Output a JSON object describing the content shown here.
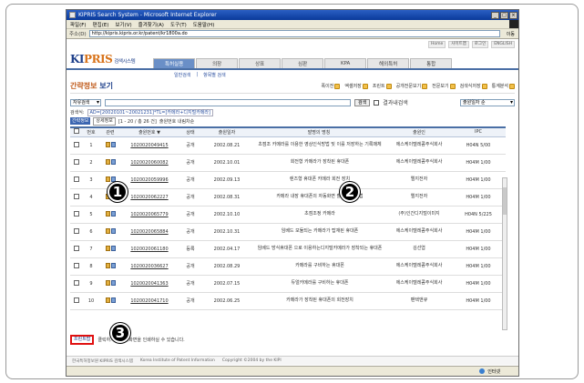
{
  "window": {
    "title": "KIPRIS Search System - Microsoft Internet Explorer",
    "controls": [
      "_",
      "□",
      "×"
    ]
  },
  "menu": [
    "파일(F)",
    "편집(E)",
    "보기(V)",
    "즐겨찾기(A)",
    "도구(T)",
    "도움말(H)"
  ],
  "address": {
    "label": "주소(D)",
    "url": "http://kipris.kipris.or.kr/patent/kr1800a.do",
    "go": "이동"
  },
  "toplinks": [
    "Home",
    "사이트맵",
    "로그인",
    "ENGLISH"
  ],
  "brand": {
    "name_a": "KI",
    "name_b": "PRIS",
    "suffix": "검색시스템"
  },
  "tabs": [
    {
      "label": "특허실용",
      "active": true
    },
    {
      "label": "의장",
      "active": false
    },
    {
      "label": "상표",
      "active": false
    },
    {
      "label": "심판",
      "active": false
    },
    {
      "label": "KPA",
      "active": false
    },
    {
      "label": "해외특허",
      "active": false
    },
    {
      "label": "통합",
      "active": false
    }
  ],
  "subtabs": [
    "일반검색",
    "항목별 검색"
  ],
  "page": {
    "title_a": "간략정보",
    "title_b": " 보기",
    "tools": [
      "폭이전",
      "엑셀저장",
      "프린트",
      "공개전문보기",
      "전문보기",
      "검색식저장",
      "통계분석"
    ]
  },
  "search": {
    "field": "자유검색",
    "button": "검색",
    "option": "결과내검색",
    "sort": "출원일자 순",
    "expr_label": "검색식:",
    "expr": "AD=[20020101~20021231]*TL=[카메라+디지털카메라]"
  },
  "results": {
    "view_a": "간략정보",
    "view_b": "상세정보",
    "summary": "[1 - 20 / 총 26 건]",
    "sort_hint": "출원번호 내림차순"
  },
  "columns": [
    "",
    "번호",
    "관련",
    "출원번호 ▼",
    "상태",
    "출원일자",
    "발명의 명칭",
    "출원인",
    "IPC"
  ],
  "rows": [
    {
      "no": "1",
      "app": "1020020049415",
      "status": "공개",
      "date": "2002.08.21",
      "title": "초점조 카메라를 이용한 영상인식방법 및 이를 저장하는 기록매체",
      "applicant": "에스케이텔레콤주식회사",
      "ipc": "H04N 5/00"
    },
    {
      "no": "2",
      "app": "1020020060082",
      "status": "공개",
      "date": "2002.10.01",
      "title": "회전형 카메라가 장착된 휴대폰",
      "applicant": "에스케이텔레콤주식회사",
      "ipc": "H04M 1/00"
    },
    {
      "no": "3",
      "app": "1020020059996",
      "status": "공개",
      "date": "2002.09.13",
      "title": "렌즈형 휴대폰 카메라 회전 장치",
      "applicant": "엘지전자",
      "ipc": "H04M 1/00"
    },
    {
      "no": "4",
      "app": "1020020062227",
      "status": "공개",
      "date": "2002.08.31",
      "title": "카메라 내장 휴대폰의 자동화면 촬영 이용방법",
      "applicant": "엘지전자",
      "ipc": "H04M 1/00"
    },
    {
      "no": "5",
      "app": "1020020065779",
      "status": "공개",
      "date": "2002.10.10",
      "title": "초점조정 카메라",
      "applicant": "(주)인간디지털이미지",
      "ipc": "H04N 5/225"
    },
    {
      "no": "6",
      "app": "1020020065884",
      "status": "공개",
      "date": "2002.10.31",
      "title": "임베드 모듈되는 카메라가 탑재된 휴대폰",
      "applicant": "에스케이텔레콤주식회사",
      "ipc": "H04M 1/00"
    },
    {
      "no": "7",
      "app": "1020020061180",
      "status": "등록",
      "date": "2002.04.17",
      "title": "임베드 방식휴대폰 으로 이용하는디지털카메라가 장착되는 휴대폰",
      "applicant": "김선엽",
      "ipc": "H04M 1/00"
    },
    {
      "no": "8",
      "app": "1020020036627",
      "status": "공개",
      "date": "2002.08.29",
      "title": "카메라를 구비하는 휴대폰",
      "applicant": "에스케이텔레콤주식회사",
      "ipc": "H04M 1/00"
    },
    {
      "no": "9",
      "app": "1020020041363",
      "status": "공개",
      "date": "2002.07.15",
      "title": "듀얼카메라를 구비하는 휴대폰",
      "applicant": "에스케이텔레콤주식회사",
      "ipc": "H04M 1/00"
    },
    {
      "no": "10",
      "app": "1020020041710",
      "status": "공개",
      "date": "2002.06.25",
      "title": "카메라가 장착된 휴대폰의 회전장치",
      "applicant": "팬택앤큐",
      "ipc": "H04M 1/00"
    }
  ],
  "bottom": {
    "print_label": "프린트팝",
    "note": "클릭하시면 결과화면을 인쇄하실 수 있습니다."
  },
  "footer": [
    "한국특허정보원 KIPRIS 검색시스템",
    "Korea Institute of Patent Information",
    "Copyright ©2004 by the KIPI"
  ],
  "status": {
    "zone": "인터넷"
  },
  "markers": [
    "1",
    "2",
    "3"
  ]
}
